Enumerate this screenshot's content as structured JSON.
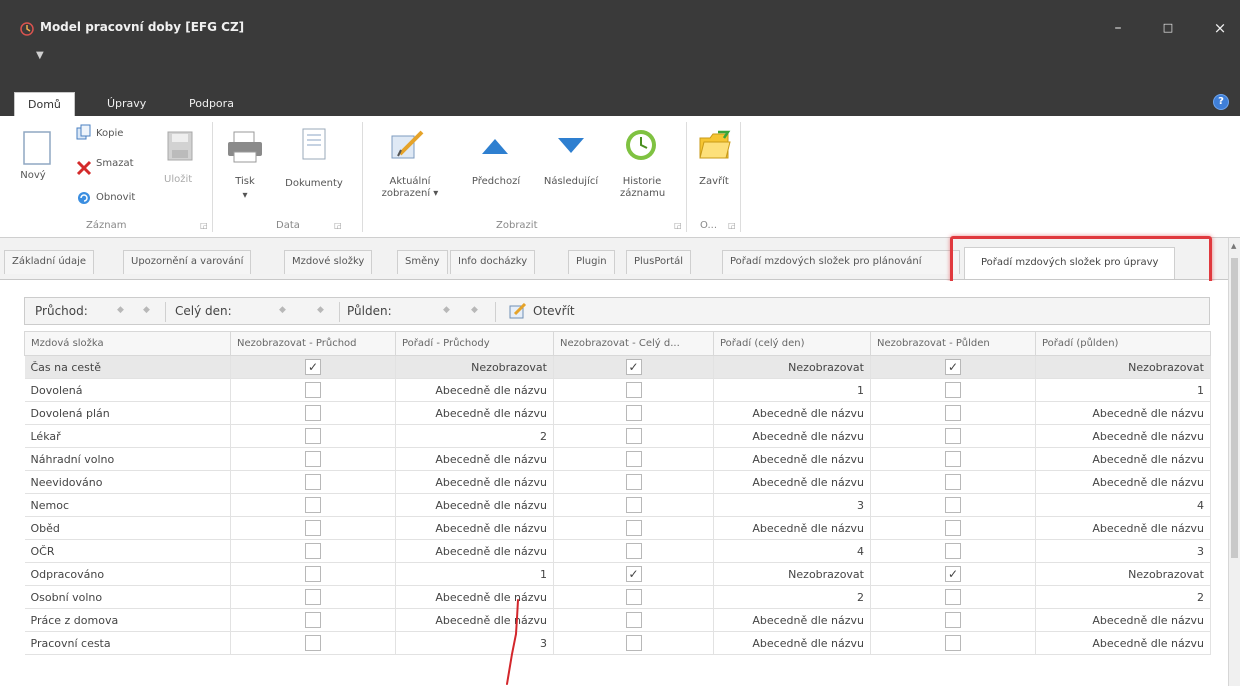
{
  "window": {
    "title": "Model pracovní doby [EFG CZ]",
    "qa_dot": "▼",
    "minimize": "–",
    "maximize": "□",
    "close": "×"
  },
  "ribbon_tabs": [
    "Domů",
    "Úpravy",
    "Podpora"
  ],
  "ribbon": {
    "zaznam": {
      "novy": "Nový",
      "kopie": "Kopie",
      "smazat": "Smazat",
      "obnovit": "Obnovit",
      "ulozit": "Uložit",
      "group": "Záznam"
    },
    "data": {
      "tisk": "Tisk",
      "dokumenty": "Dokumenty",
      "group": "Data"
    },
    "zobrazit": {
      "aktualni_1": "Aktuální",
      "aktualni_2": "zobrazení ▾",
      "predchozi": "Předchozí",
      "nasledujici": "Následující",
      "historie_1": "Historie",
      "historie_2": "záznamu",
      "group": "Zobrazit"
    },
    "o": {
      "zavrit": "Zavřít",
      "group": "O..."
    }
  },
  "doc_tabs": [
    "Základní údaje",
    "Upozornění a varování",
    "Mzdové složky",
    "Směny",
    "Info docházky",
    "Plugin",
    "PlusPortál",
    "Pořadí mzdových složek pro plánování",
    "Pořadí mzdových složek pro úpravy"
  ],
  "toolbar": {
    "pruchod": "Průchod:",
    "cely_den": "Celý den:",
    "pulden": "Půlden:",
    "otevrit": "Otevřít"
  },
  "grid": {
    "columns": [
      "Mzdová složka",
      "Nezobrazovat - Průchod",
      "Pořadí - Průchody",
      "Nezobrazovat - Celý d...",
      "Pořadí (celý den)",
      "Nezobrazovat - Půlden",
      "Pořadí (půlden)"
    ],
    "rows": [
      {
        "name": "Čas na cestě",
        "cb1": true,
        "p1": "Nezobrazovat",
        "cb2": true,
        "p2": "Nezobrazovat",
        "cb3": true,
        "p3": "Nezobrazovat",
        "selected": true
      },
      {
        "name": "Dovolená",
        "cb1": false,
        "p1": "Abecedně dle názvu",
        "cb2": false,
        "p2": "1",
        "cb3": false,
        "p3": "1"
      },
      {
        "name": "Dovolená plán",
        "cb1": false,
        "p1": "Abecedně dle názvu",
        "cb2": false,
        "p2": "Abecedně dle názvu",
        "cb3": false,
        "p3": "Abecedně dle názvu"
      },
      {
        "name": "Lékař",
        "cb1": false,
        "p1": "2",
        "cb2": false,
        "p2": "Abecedně dle názvu",
        "cb3": false,
        "p3": "Abecedně dle názvu"
      },
      {
        "name": "Náhradní volno",
        "cb1": false,
        "p1": "Abecedně dle názvu",
        "cb2": false,
        "p2": "Abecedně dle názvu",
        "cb3": false,
        "p3": "Abecedně dle názvu"
      },
      {
        "name": "Neevidováno",
        "cb1": false,
        "p1": "Abecedně dle názvu",
        "cb2": false,
        "p2": "Abecedně dle názvu",
        "cb3": false,
        "p3": "Abecedně dle názvu"
      },
      {
        "name": "Nemoc",
        "cb1": false,
        "p1": "Abecedně dle názvu",
        "cb2": false,
        "p2": "3",
        "cb3": false,
        "p3": "4"
      },
      {
        "name": "Oběd",
        "cb1": false,
        "p1": "Abecedně dle názvu",
        "cb2": false,
        "p2": "Abecedně dle názvu",
        "cb3": false,
        "p3": "Abecedně dle názvu"
      },
      {
        "name": "OČR",
        "cb1": false,
        "p1": "Abecedně dle názvu",
        "cb2": false,
        "p2": "4",
        "cb3": false,
        "p3": "3"
      },
      {
        "name": "Odpracováno",
        "cb1": false,
        "p1": "1",
        "cb2": true,
        "p2": "Nezobrazovat",
        "cb3": true,
        "p3": "Nezobrazovat"
      },
      {
        "name": "Osobní volno",
        "cb1": false,
        "p1": "Abecedně dle názvu",
        "cb2": false,
        "p2": "2",
        "cb3": false,
        "p3": "2"
      },
      {
        "name": "Práce z domova",
        "cb1": false,
        "p1": "Abecedně dle názvu",
        "cb2": false,
        "p2": "Abecedně dle názvu",
        "cb3": false,
        "p3": "Abecedně dle názvu"
      },
      {
        "name": "Pracovní cesta",
        "cb1": false,
        "p1": "3",
        "cb2": false,
        "p2": "Abecedně dle názvu",
        "cb3": false,
        "p3": "Abecedně dle názvu"
      }
    ]
  },
  "scroll_arrow": "▲",
  "help": "?"
}
